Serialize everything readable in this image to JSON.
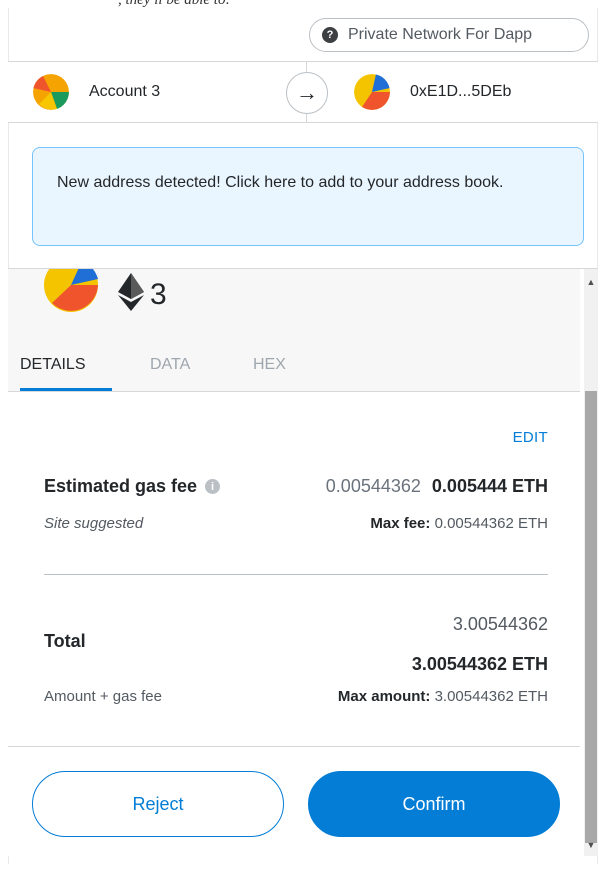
{
  "header": {
    "top_clip_text": ", they ll be able to:",
    "network_label": "Private Network For Dapp",
    "network_icon": "question-dot-icon"
  },
  "accounts": {
    "from_label": "Account 3",
    "to_label": "0xE1D...5DEb",
    "arrow_icon": "arrow-right-icon"
  },
  "alert": {
    "text": "New address detected! Click here to add to your address book."
  },
  "amount": {
    "currency_icon": "ethereum-icon",
    "value": "3"
  },
  "tabs": [
    {
      "label": "DETAILS"
    },
    {
      "label": "DATA"
    },
    {
      "label": "HEX"
    }
  ],
  "details": {
    "edit_label": "EDIT",
    "gas_title": "Estimated gas fee",
    "gas_fiat": "0.00544362",
    "gas_eth": "0.005444 ETH",
    "site_suggested": "Site suggested",
    "max_fee_label": "Max fee:",
    "max_fee_value": "0.00544362 ETH",
    "total_label": "Total",
    "total_fiat": "3.00544362",
    "total_eth": "3.00544362 ETH",
    "amount_gas_label": "Amount + gas fee",
    "max_amount_label": "Max amount:",
    "max_amount_value": "3.00544362 ETH"
  },
  "footer": {
    "reject_label": "Reject",
    "confirm_label": "Confirm"
  },
  "colors": {
    "primary": "#037dd6",
    "alert_bg": "#eaf6ff",
    "alert_border": "#75c4fd"
  }
}
